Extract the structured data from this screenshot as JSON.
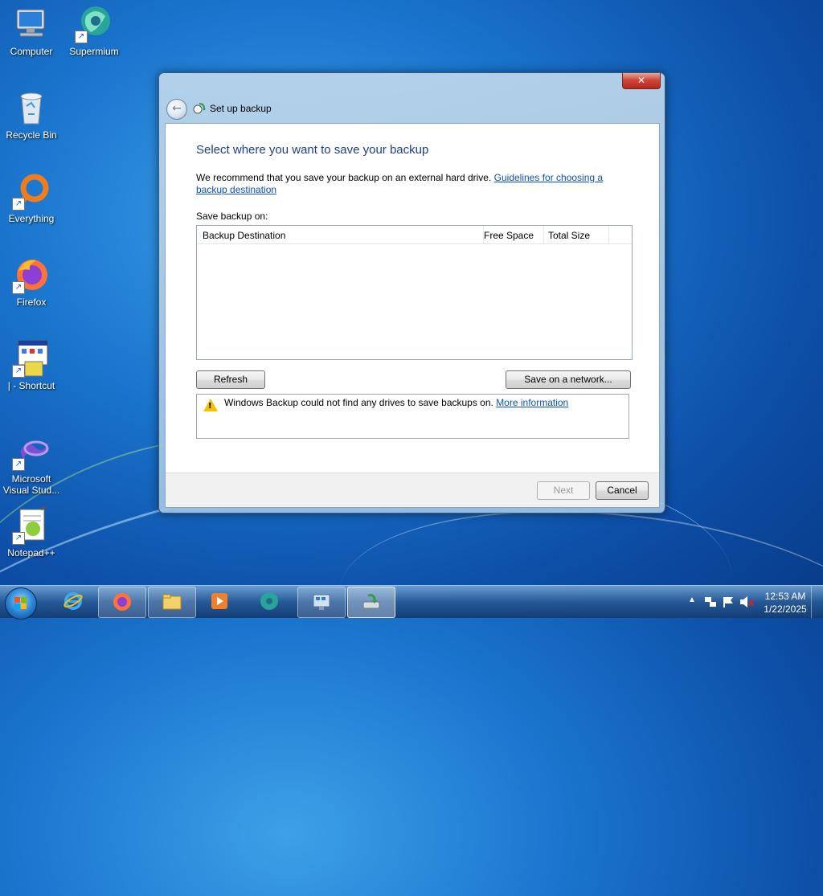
{
  "desktop": {
    "icons": [
      {
        "label": "Computer",
        "icon": "computer-icon"
      },
      {
        "label": "Supermium",
        "icon": "supermium-icon"
      },
      {
        "label": "Recycle Bin",
        "icon": "recycle-bin-icon"
      },
      {
        "label": "Everything",
        "icon": "everything-search-icon"
      },
      {
        "label": "Firefox",
        "icon": "firefox-icon"
      },
      {
        "label": "| - Shortcut",
        "icon": "app-window-icon"
      },
      {
        "label": "Microsoft Visual Stud...",
        "icon": "visual-studio-icon"
      },
      {
        "label": "Notepad++",
        "icon": "notepadpp-icon"
      }
    ]
  },
  "window": {
    "title": "Set up backup",
    "close_label": "✕",
    "heading": "Select where you want to save your backup",
    "intro_text": "We recommend that you save your backup on an external hard drive. ",
    "guidelines_link": "Guidelines for choosing a backup destination",
    "save_on_label": "Save backup on:",
    "columns": [
      "Backup Destination",
      "Free Space",
      "Total Size"
    ],
    "rows": [],
    "refresh_label": "Refresh",
    "save_network_label": "Save on a network...",
    "message_text": "Windows Backup could not find any drives to save backups on. ",
    "more_info_link": "More information",
    "next_label": "Next",
    "cancel_label": "Cancel"
  },
  "taskbar": {
    "items": [
      "start-button",
      "internet-explorer-icon",
      "firefox-icon",
      "file-explorer-icon",
      "media-player-icon",
      "supermium-icon",
      "control-panel-icon",
      "backup-restore-icon"
    ],
    "time": "12:53 AM",
    "date": "1/22/2025",
    "tray_icons": [
      "show-hidden-icons-icon",
      "network-icon",
      "action-center-flag-icon",
      "volume-muted-icon"
    ]
  },
  "colors": {
    "heading": "#1e3d8f",
    "link": "#0b52b8",
    "warning": "#f2c200",
    "close_button": "#d2473a"
  }
}
